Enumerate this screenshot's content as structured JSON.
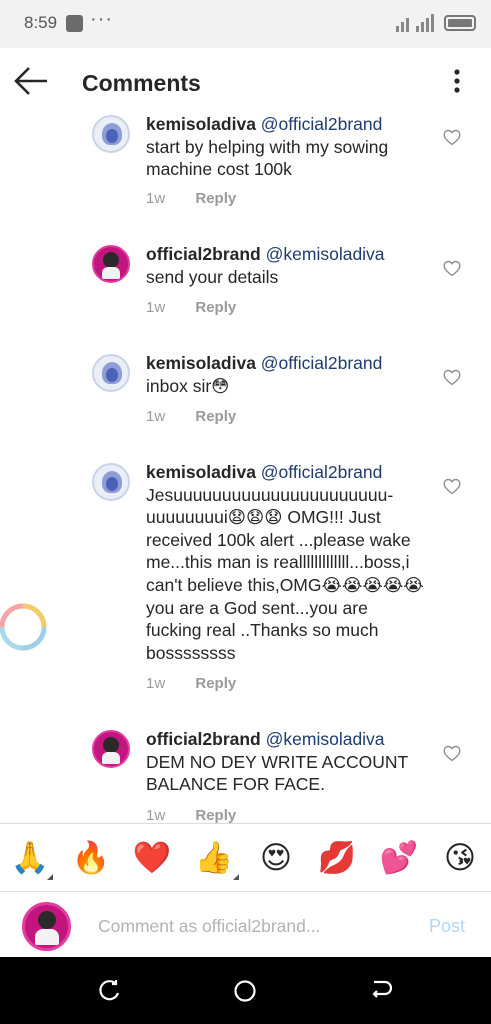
{
  "status": {
    "time": "8:59",
    "dots": "···"
  },
  "header": {
    "title": "Comments"
  },
  "comments": [
    {
      "username": "kemisoladiva",
      "mention": "@official2brand",
      "text": "start by helping with my sowing machine cost 100k",
      "age": "1w",
      "reply_label": "Reply"
    },
    {
      "username": "official2brand",
      "mention": "@kemisoladiva",
      "text": "send your details",
      "age": "1w",
      "reply_label": "Reply"
    },
    {
      "username": "kemisoladiva",
      "mention": "@official2brand",
      "text": "inbox sir😳",
      "age": "1w",
      "reply_label": "Reply"
    },
    {
      "username": "kemisoladiva",
      "mention": "@official2brand",
      "text": "Jesuuuuuuuuuuuuuuuuuuuuuu-uuuuuuuui😧😧😧 OMG!!! Just received 100k alert ...please wake me...this man is realllllllllllll...boss,i can't believe this,OMG😭😭😭😭😭 you are a God sent...you are fucking real ..Thanks so much bossssssss",
      "age": "1w",
      "reply_label": "Reply"
    },
    {
      "username": "official2brand",
      "mention": "@kemisoladiva",
      "text": "DEM NO DEY WRITE ACCOUNT BALANCE FOR FACE.",
      "age": "1w",
      "reply_label": "Reply"
    }
  ],
  "emoji_bar": [
    "🙏",
    "🔥",
    "❤️",
    "👍",
    "😍",
    "💋",
    "💕",
    "😘"
  ],
  "compose": {
    "placeholder": "Comment as official2brand...",
    "post_label": "Post"
  },
  "colors": {
    "mention": "#1f3b6f",
    "post_disabled": "#b3d5f5",
    "avatar_ring": "#e33ba0"
  }
}
